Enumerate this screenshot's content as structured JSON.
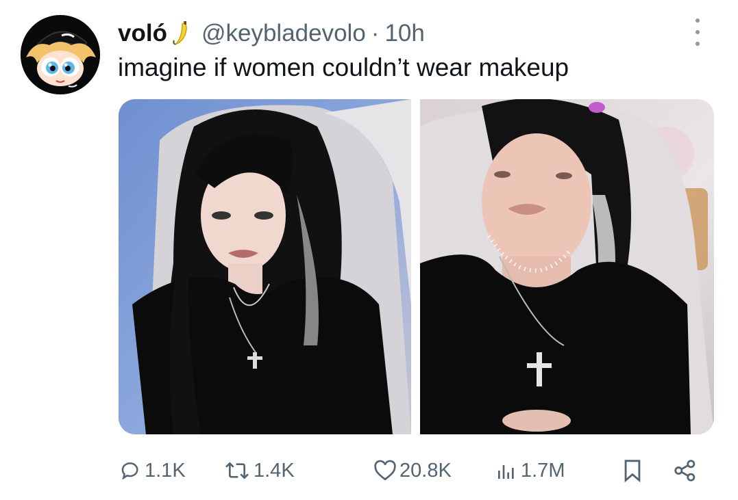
{
  "tweet": {
    "author_name": "voló",
    "author_emoji": "banana-emoji",
    "handle": "@keybladevolo",
    "separator": "·",
    "time": "10h",
    "text": "imagine if women couldn’t wear makeup",
    "images": [
      {
        "alt": "woman with black hair and makeup, black top, cross necklace"
      },
      {
        "alt": "same woman without makeup, black top, pearl necklace and cross"
      }
    ]
  },
  "actions": {
    "replies": "1.1K",
    "reposts": "1.4K",
    "likes": "20.8K",
    "views": "1.7M"
  },
  "icons": [
    "reply-icon",
    "repost-icon",
    "like-icon",
    "views-icon",
    "bookmark-icon",
    "share-icon",
    "more-icon"
  ],
  "colors": {
    "text": "#0f1419",
    "secondary": "#536471",
    "background": "#ffffff"
  }
}
